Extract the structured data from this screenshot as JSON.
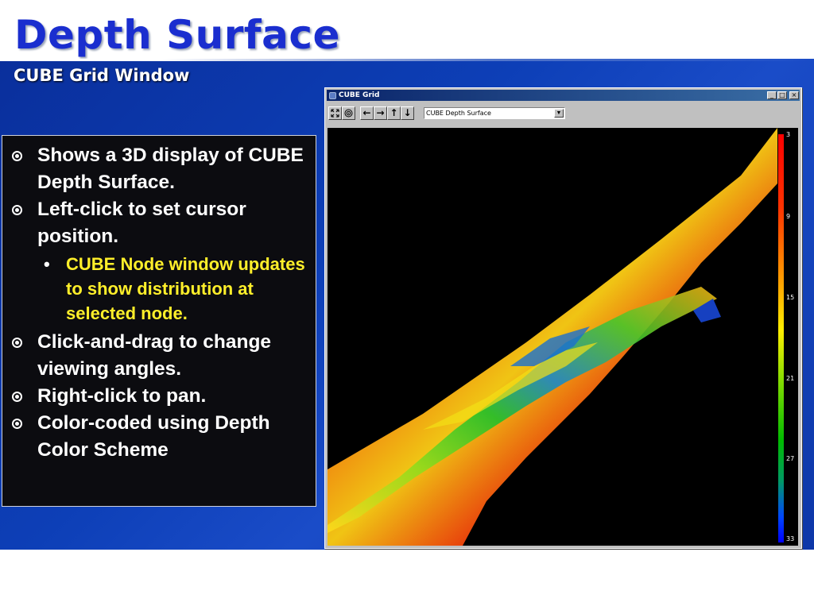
{
  "slide": {
    "title": "Depth Surface",
    "subtitle": "CUBE Grid Window"
  },
  "bullets": [
    {
      "text": "Shows a 3D display of CUBE Depth Surface."
    },
    {
      "text": "Left-click to set cursor position."
    },
    {
      "text": "CUBE Node window updates to show distribution at selected node.",
      "level": 2
    },
    {
      "text": "Click-and-drag to change viewing angles."
    },
    {
      "text": "Right-click to pan."
    },
    {
      "text": "Color-coded using Depth Color Scheme"
    }
  ],
  "window": {
    "title": "CUBE Grid",
    "minimize_label": "_",
    "maximize_label": "□",
    "close_label": "×",
    "toolbar": {
      "fit_icon": "expand-icon",
      "target_icon": "target-icon",
      "left_label": "←",
      "right_label": "→",
      "up_label": "↑",
      "down_label": "↓"
    },
    "surface_select": {
      "value": "CUBE Depth Surface"
    },
    "depth_scale": {
      "ticks": [
        "3",
        "9",
        "15",
        "21",
        "27",
        "33"
      ],
      "colors": [
        "#ff0000",
        "#ff9900",
        "#ffee00",
        "#00bb00",
        "#0000ff"
      ]
    }
  },
  "colors": {
    "title": "#1a2ecf",
    "band": "#0d3fb7",
    "sub_bullet": "#ffef2a"
  }
}
